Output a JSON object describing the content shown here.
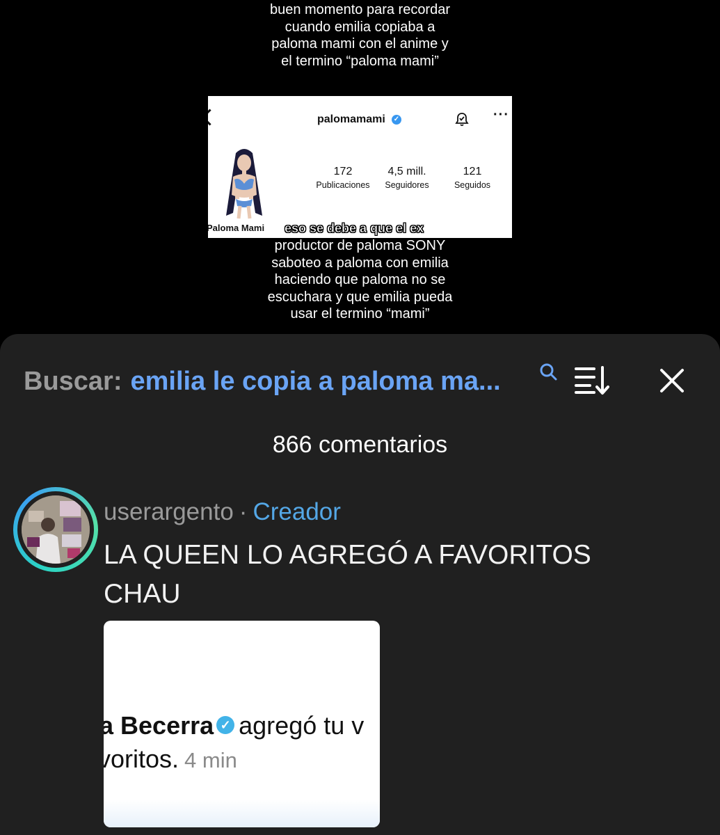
{
  "video": {
    "caption_top": [
      "buen momento para recordar",
      "cuando emilia copiaba a",
      "paloma mami con el anime y",
      "el termino “paloma mami”"
    ],
    "caption_bottom": [
      "productor de paloma SONY",
      "saboteo a paloma con emilia",
      "haciendo que paloma no se",
      "escuchara y que emilia pueda",
      "usar el termino “mami”"
    ],
    "overlay_text": "eso se debe a que el ex",
    "profile": {
      "username": "palomamami",
      "display_name": "Paloma Mami",
      "stats": [
        {
          "value": "172",
          "label": "Publicaciones"
        },
        {
          "value": "4,5 mill.",
          "label": "Seguidores"
        },
        {
          "value": "121",
          "label": "Seguidos"
        }
      ]
    }
  },
  "comments_sheet": {
    "search_prefix": "Buscar:",
    "search_query": "emilia le copia a paloma ma...",
    "count_label": "866 comentarios",
    "comment": {
      "username": "userargento",
      "separator": "·",
      "role": "Creador",
      "text": "LA QUEEN LO AGREGÓ A FAVORITOS CHAU",
      "attachment": {
        "name": "a Becerra",
        "action": "agregó tu v",
        "line2": "voritos.",
        "time": "4 min"
      }
    }
  },
  "colors": {
    "sheet_bg": "#202020",
    "query_blue": "#6aa4f5",
    "creator_blue": "#54a7e6",
    "muted_gray": "#9a9a9a"
  }
}
